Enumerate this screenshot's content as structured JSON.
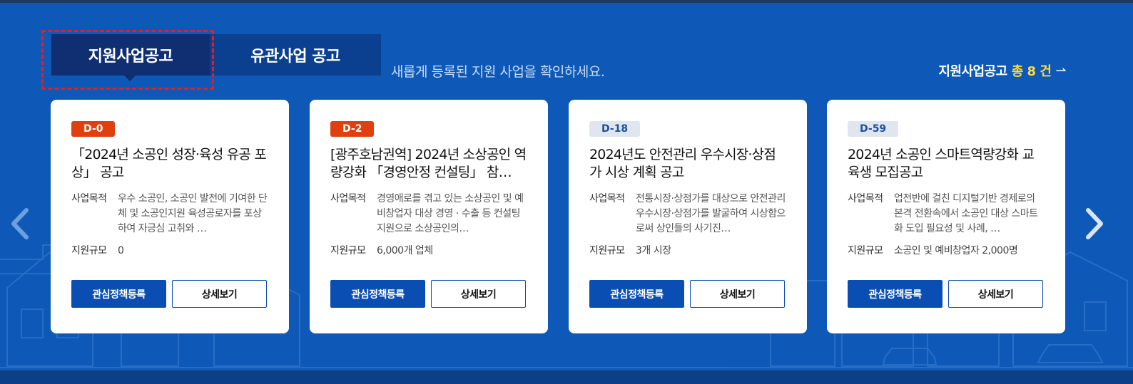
{
  "tabs": {
    "active_label": "지원사업공고",
    "inactive_label": "유관사업 공고"
  },
  "subtitle": "새롭게 등록된 지원 사업을 확인하세요.",
  "total": {
    "prefix": "지원사업공고",
    "count_text": "총 8 건",
    "arrow": "⇀"
  },
  "nav": {
    "prev_icon": "chevron-left-icon",
    "next_icon": "chevron-right-icon"
  },
  "colors": {
    "background": "#0e59b8",
    "tab_active": "#0f2f72",
    "badge_urgent": "#e0400f",
    "badge_normal": "#dfe6f0",
    "primary_button": "#0a4eb4",
    "count_highlight": "#ffd93b"
  },
  "cards": [
    {
      "badge": "D-0",
      "urgent": true,
      "title": "「2024년 소공인 성장·육성 유공 포상」 공고",
      "purpose_label": "사업목적",
      "purpose": "우수 소공인, 소공인 발전에 기여한 단체 및 소공인지원 육성공로자를 포상하여 자긍심 고취와 …",
      "scale_label": "지원규모",
      "scale": "0",
      "btn_primary": "관심정책등록",
      "btn_secondary": "상세보기"
    },
    {
      "badge": "D-2",
      "urgent": true,
      "title": "[광주호남권역] 2024년 소상공인 역량강화 「경영안정 컨설팅」 참…",
      "purpose_label": "사업목적",
      "purpose": "경영애로를 겪고 있는 소상공인 및 예비창업자 대상 경영 · 수출 등 컨설팅 지원으로 소상공인의…",
      "scale_label": "지원규모",
      "scale": "6,000개 업체",
      "btn_primary": "관심정책등록",
      "btn_secondary": "상세보기"
    },
    {
      "badge": "D-18",
      "urgent": false,
      "title": "2024년도 안전관리 우수시장·상점가 시상 계획 공고",
      "purpose_label": "사업목적",
      "purpose": "전통시장·상점가를 대상으로 안전관리 우수시장·상점가를 발굴하여 시상함으로써 상인들의 사기진…",
      "scale_label": "지원규모",
      "scale": "3개 시장",
      "btn_primary": "관심정책등록",
      "btn_secondary": "상세보기"
    },
    {
      "badge": "D-59",
      "urgent": false,
      "title": "2024년 소공인 스마트역량강화 교육생 모집공고",
      "purpose_label": "사업목적",
      "purpose": "업전반에 걸친 디지털기반 경제로의 본격 전환속에서 소공인 대상 스마트화 도입 필요성 및 사례, …",
      "scale_label": "지원규모",
      "scale": "소공인 및 예비창업자 2,000명",
      "btn_primary": "관심정책등록",
      "btn_secondary": "상세보기"
    }
  ]
}
